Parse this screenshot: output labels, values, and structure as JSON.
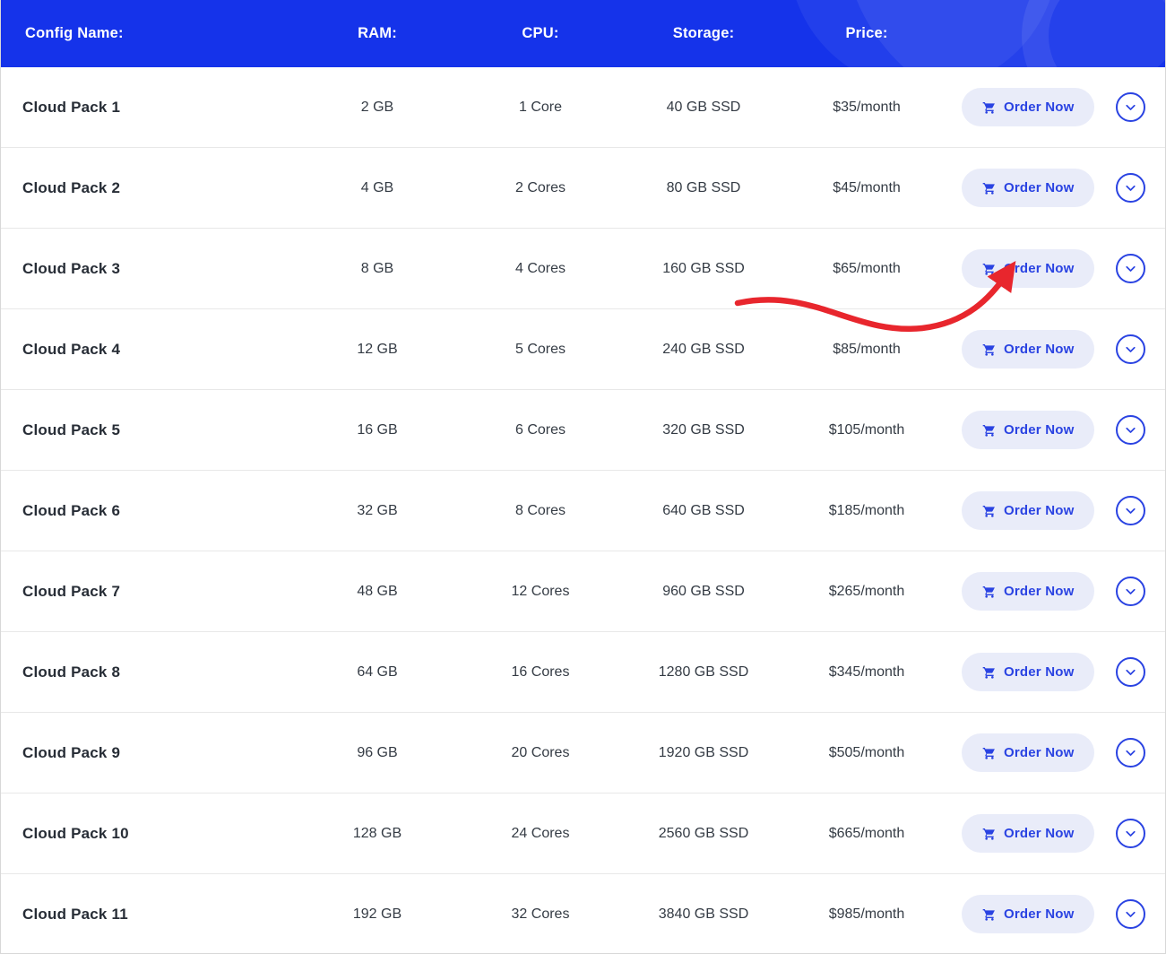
{
  "header": {
    "columns": [
      "Config Name:",
      "RAM:",
      "CPU:",
      "Storage:",
      "Price:"
    ]
  },
  "order_button_label": "Order Now",
  "rows": [
    {
      "name": "Cloud Pack 1",
      "ram": "2 GB",
      "cpu": "1 Core",
      "storage": "40 GB SSD",
      "price": "$35/month"
    },
    {
      "name": "Cloud Pack 2",
      "ram": "4 GB",
      "cpu": "2 Cores",
      "storage": "80 GB SSD",
      "price": "$45/month"
    },
    {
      "name": "Cloud Pack 3",
      "ram": "8 GB",
      "cpu": "4 Cores",
      "storage": "160 GB SSD",
      "price": "$65/month"
    },
    {
      "name": "Cloud Pack 4",
      "ram": "12 GB",
      "cpu": "5 Cores",
      "storage": "240 GB SSD",
      "price": "$85/month"
    },
    {
      "name": "Cloud Pack 5",
      "ram": "16 GB",
      "cpu": "6 Cores",
      "storage": "320 GB SSD",
      "price": "$105/month"
    },
    {
      "name": "Cloud Pack 6",
      "ram": "32 GB",
      "cpu": "8 Cores",
      "storage": "640 GB SSD",
      "price": "$185/month"
    },
    {
      "name": "Cloud Pack 7",
      "ram": "48 GB",
      "cpu": "12 Cores",
      "storage": "960 GB SSD",
      "price": "$265/month"
    },
    {
      "name": "Cloud Pack 8",
      "ram": "64 GB",
      "cpu": "16 Cores",
      "storage": "1280 GB SSD",
      "price": "$345/month"
    },
    {
      "name": "Cloud Pack 9",
      "ram": "96 GB",
      "cpu": "20 Cores",
      "storage": "1920 GB SSD",
      "price": "$505/month"
    },
    {
      "name": "Cloud Pack 10",
      "ram": "128 GB",
      "cpu": "24 Cores",
      "storage": "2560 GB SSD",
      "price": "$665/month"
    },
    {
      "name": "Cloud Pack 11",
      "ram": "192 GB",
      "cpu": "32 Cores",
      "storage": "3840 GB SSD",
      "price": "$985/month"
    }
  ],
  "colors": {
    "header_bg": "#1533ea",
    "accent_blue": "#2a43e2",
    "button_bg": "#e9ecf9",
    "arrow_red": "#e8262d"
  },
  "annotation": {
    "arrow_target": "Cloud Pack 3 Order Now button"
  }
}
